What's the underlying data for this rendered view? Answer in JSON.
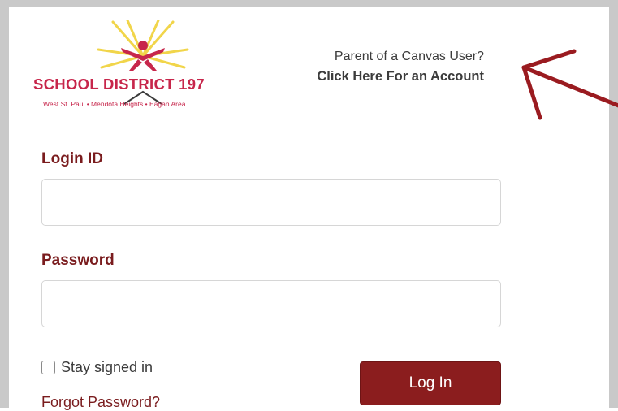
{
  "logo": {
    "name": "SCHOOL DISTRICT 197",
    "tagline": "West St. Paul • Mendota Heights • Eagan Area",
    "colors": {
      "red": "#c7264b",
      "yellow": "#f1d54a"
    }
  },
  "parent_signup": {
    "question": "Parent of a Canvas User?",
    "link_label": "Click Here For an Account"
  },
  "form": {
    "login_id_label": "Login ID",
    "login_id_value": "",
    "password_label": "Password",
    "password_value": "",
    "stay_signed_in_label": "Stay signed in",
    "stay_signed_in_checked": false,
    "submit_label": "Log In",
    "forgot_password_label": "Forgot Password?"
  },
  "colors": {
    "brand_maroon": "#8b1d1e",
    "label_maroon": "#7a1c1e",
    "frame_gray": "#c9c9c9"
  }
}
